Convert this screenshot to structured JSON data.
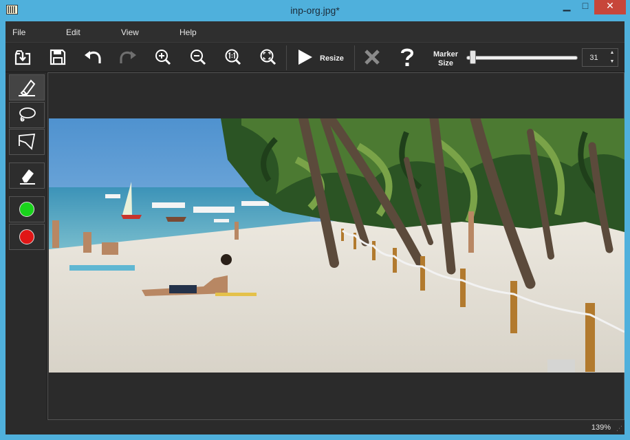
{
  "window": {
    "title": "inp-org.jpg*",
    "min_glyph": "▁",
    "max_glyph": "□",
    "close_glyph": "✕"
  },
  "menu": {
    "items": [
      {
        "label": "File"
      },
      {
        "label": "Edit"
      },
      {
        "label": "View"
      },
      {
        "label": "Help"
      }
    ]
  },
  "toolbar": {
    "resize_label": "Resize",
    "marker_size_label": "Marker Size",
    "marker_size_value": "31",
    "marker_size_fraction": 0.03,
    "icons": [
      "open-icon",
      "save-icon",
      "undo-icon",
      "redo-icon",
      "zoom-in-icon",
      "zoom-out-icon",
      "zoom-actual-icon",
      "zoom-fit-icon",
      "play-icon",
      "cancel-icon",
      "help-icon"
    ]
  },
  "tools": {
    "icons": [
      "marker-icon",
      "lasso-icon",
      "polygon-lasso-icon",
      "eraser-icon"
    ],
    "green": "#19d31b",
    "red": "#e01616"
  },
  "status": {
    "zoom": "139%"
  },
  "colors": {
    "titlebar": "#4fb0dc",
    "panel": "#2b2b2b",
    "close": "#c7463a"
  }
}
